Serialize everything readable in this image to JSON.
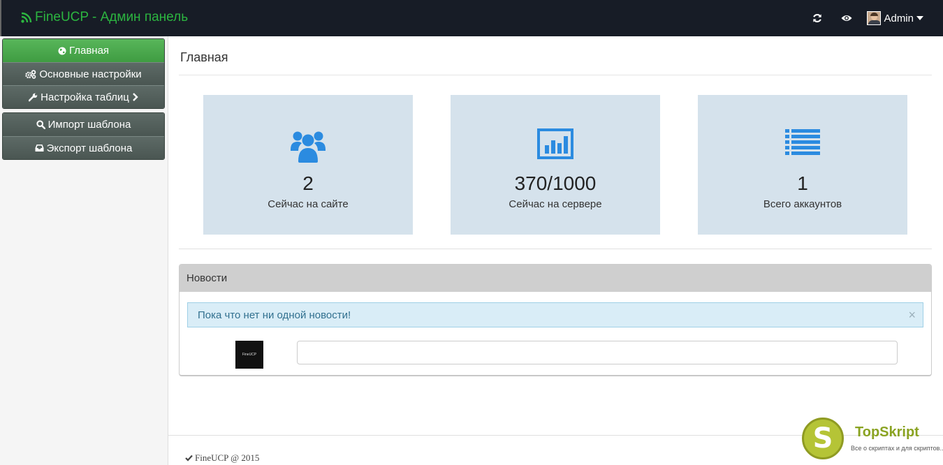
{
  "navbar": {
    "brand": "FineUCP - Админ панель",
    "user_name": "Admin"
  },
  "sidebar": {
    "group1": [
      {
        "label": "Главная",
        "icon": "globe-icon",
        "active": true
      },
      {
        "label": "Основные настройки",
        "icon": "cogs-icon"
      },
      {
        "label": "Настройка таблиц",
        "icon": "wrench-icon"
      }
    ],
    "group2": [
      {
        "label": "Импорт шаблона",
        "icon": "search-icon"
      },
      {
        "label": "Экспорт шаблона",
        "icon": "inbox-icon"
      }
    ]
  },
  "main": {
    "title": "Главная",
    "stats": [
      {
        "value": "2",
        "label": "Сейчас на сайте",
        "icon": "users-icon"
      },
      {
        "value": "370/1000",
        "label": "Сейчас на сервере",
        "icon": "bar-chart-icon"
      },
      {
        "value": "1",
        "label": "Всего аккаунтов",
        "icon": "list-icon"
      }
    ],
    "news": {
      "heading": "Новости",
      "alert": "Пока что нет ни одной новости!",
      "close": "×",
      "thumb_text": "FineUCP"
    }
  },
  "footer": {
    "text": "FineUCP @ 2015"
  },
  "watermark": {
    "letter": "S",
    "name": "TopSkript",
    "tagline": "Все о скриптах и для скриптов..."
  },
  "colors": {
    "navbar_bg": "#171c26",
    "brand": "#2cb540",
    "tile_bg": "#d5e2ec",
    "icon_blue": "#2b8be0",
    "menu_active": "#4caf50",
    "menu_item": "#55625e"
  }
}
